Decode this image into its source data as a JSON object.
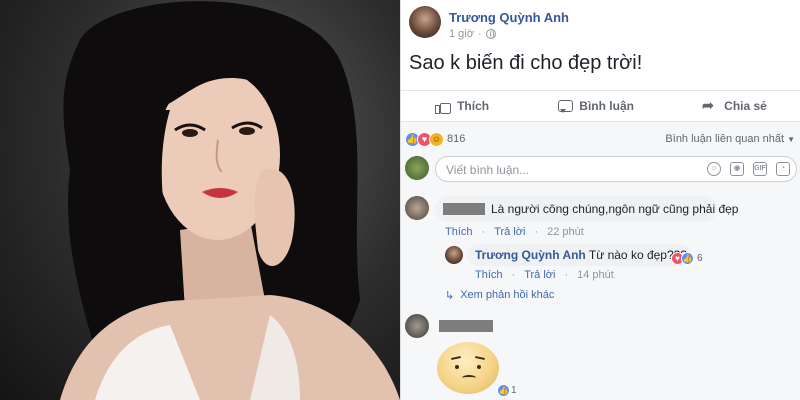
{
  "post": {
    "author": "Trương Quỳnh Anh",
    "time": "1 giờ",
    "text": "Sao k biến đi cho đẹp trời!"
  },
  "actions": {
    "like_label": "Thích",
    "comment_label": "Bình luận",
    "share_label": "Chia sẻ"
  },
  "reactions": {
    "count": "816",
    "sort_label": "Bình luận liên quan nhất",
    "icons": [
      "like-icon",
      "love-icon",
      "haha-icon"
    ]
  },
  "comment_box": {
    "placeholder": "Viết bình luận..."
  },
  "comments": [
    {
      "text": "Là người công chúng,ngôn ngữ cũng phải đẹp",
      "like_label": "Thích",
      "reply_label": "Trả lời",
      "time": "22 phút"
    }
  ],
  "reply": {
    "author": "Trương Quỳnh Anh",
    "text": "Từ nào ko đẹp???",
    "like_label": "Thích",
    "reply_label": "Trả lời",
    "time": "14 phút",
    "reaction_count": "6"
  },
  "more_replies_label": "Xem phản hồi khác",
  "sticker_comment": {
    "reaction_count": "1"
  },
  "colors": {
    "link": "#365899",
    "action_link": "#4267b2",
    "like": "#5890ff",
    "love": "#f25268",
    "haha": "#f7b125"
  }
}
